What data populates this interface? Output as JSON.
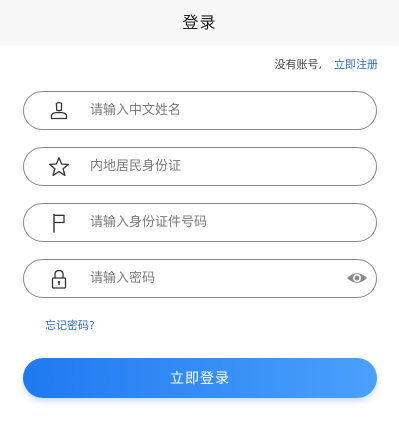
{
  "header": {
    "title": "登录"
  },
  "register": {
    "prompt": "没有账号,",
    "link_label": "立即注册"
  },
  "form": {
    "name_placeholder": "请输入中文姓名",
    "id_type_placeholder": "内地居民身份证",
    "id_number_placeholder": "请输入身份证件号码",
    "password_placeholder": "请输入密码"
  },
  "icons": {
    "name": "user-icon",
    "id_type": "star-icon",
    "id_number": "flag-icon",
    "password": "lock-icon",
    "toggle": "eye-icon"
  },
  "forgot_label": "忘记密码?",
  "login_label": "立即登录",
  "colors": {
    "accent_blue": "#2f80ed",
    "link_blue": "#2d6dc0",
    "button_gradient_start": "#1f7af0",
    "button_gradient_end": "#4aa0fb"
  }
}
